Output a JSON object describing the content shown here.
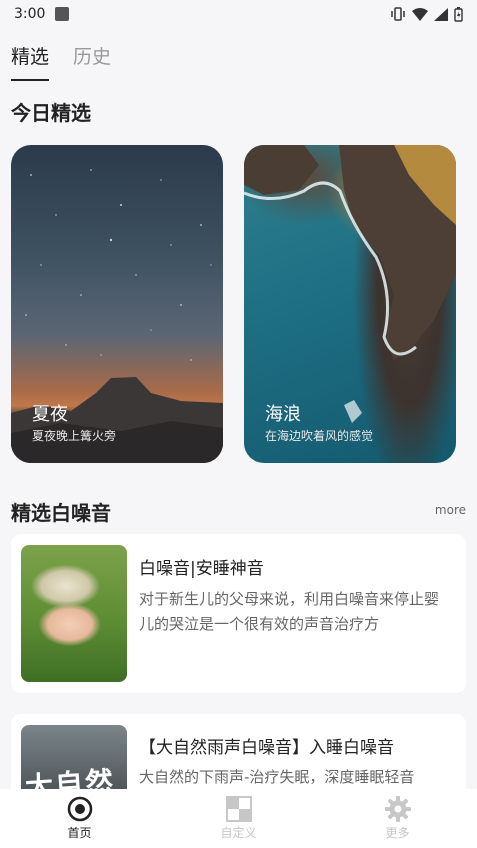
{
  "status_bar": {
    "time": "3:00"
  },
  "tabs": [
    {
      "label": "精选",
      "active": true
    },
    {
      "label": "历史",
      "active": false
    }
  ],
  "today_section": {
    "title": "今日精选",
    "cards": [
      {
        "title": "夏夜",
        "subtitle": "夏夜晚上篝火旁"
      },
      {
        "title": "海浪",
        "subtitle": "在海边吹着风的感觉"
      }
    ]
  },
  "white_noise_section": {
    "title": "精选白噪音",
    "more_label": "more",
    "items": [
      {
        "title": "白噪音|安睡神音",
        "description": "对于新生儿的父母来说，利用白噪音来停止婴儿的哭泣是一个很有效的声音治疗方"
      },
      {
        "title": "【大自然雨声白噪音】入睡白噪音",
        "description": "大自然的下雨声-治疗失眠，深度睡眠轻音",
        "thumb_text": "大自然"
      }
    ]
  },
  "bottom_nav": [
    {
      "label": "首页",
      "icon": "home-record-icon",
      "active": true
    },
    {
      "label": "自定义",
      "icon": "custom-grid-icon",
      "active": false
    },
    {
      "label": "更多",
      "icon": "gear-icon",
      "active": false
    }
  ],
  "colors": {
    "background": "#f6f6f9",
    "active_text": "#222222",
    "inactive_tab": "#999999",
    "inactive_nav": "#c7c7c7"
  }
}
